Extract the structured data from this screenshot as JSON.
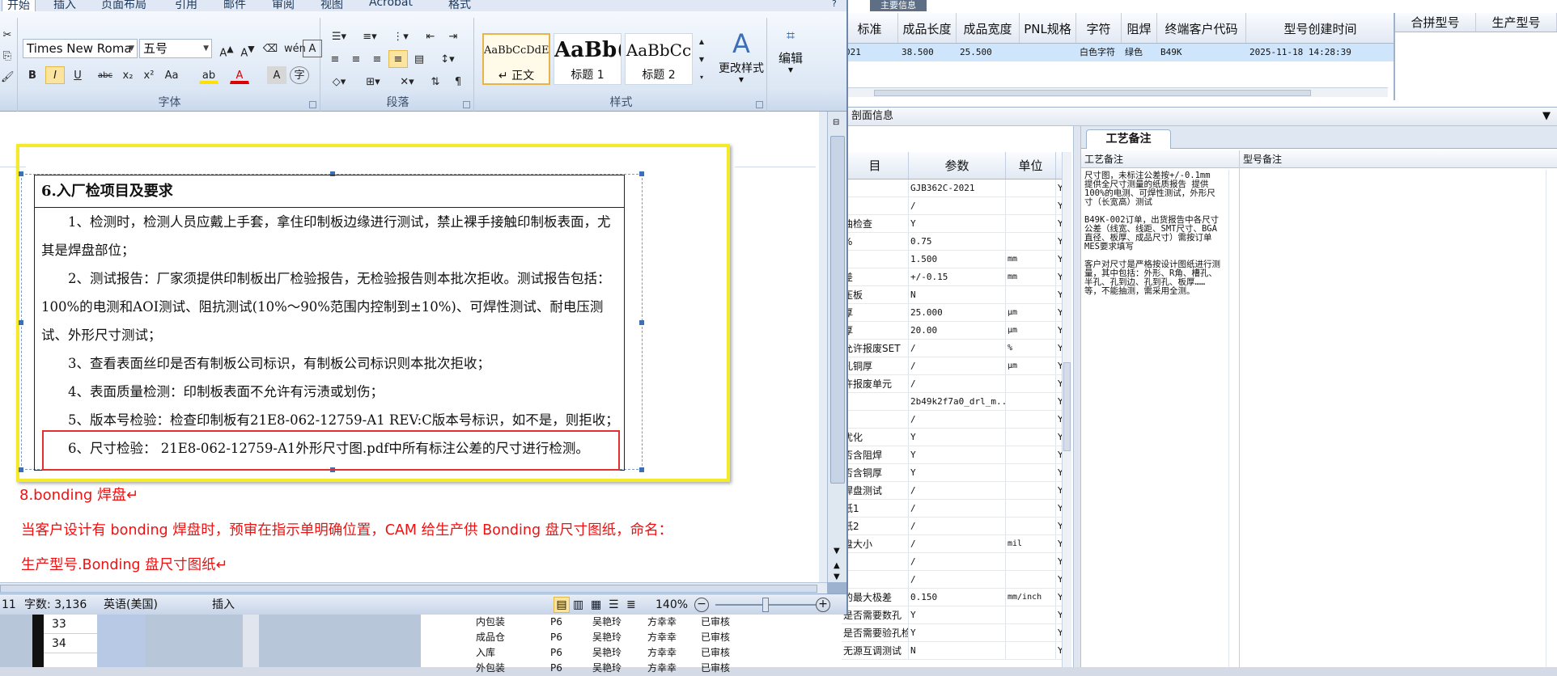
{
  "word": {
    "tabs": [
      "开始",
      "插入",
      "页面布局",
      "引用",
      "邮件",
      "审阅",
      "视图",
      "Acrobat",
      "格式"
    ],
    "font_name": "Times New Roma",
    "font_size": "五号",
    "groups": {
      "font": "字体",
      "paragraph": "段落",
      "styles": "样式",
      "change_styles": "更改样式",
      "edit": "编辑"
    },
    "styles": [
      {
        "preview": "AaBbCcDdEe",
        "name": "↵ 正文"
      },
      {
        "preview": "AaBb(",
        "name": "标题 1"
      },
      {
        "preview": "AaBbCc",
        "name": "标题 2"
      }
    ],
    "format_buttons": [
      "B",
      "I",
      "U",
      "abc",
      "x₂",
      "x²",
      "Aa",
      "A",
      "A"
    ],
    "status": {
      "page": "11",
      "word_count": "字数: 3,136",
      "language": "英语(美国)",
      "mode": "插入",
      "zoom": "140%"
    }
  },
  "document": {
    "section_title": "6.入厂检项目及要求",
    "paragraphs": [
      "1、检测时，检测人员应戴上手套，拿住印制板边缘进行测试，禁止裸手接触印制板表面，尤其是焊盘部位；",
      "2、测试报告：厂家须提供印制板出厂检验报告，无检验报告则本批次拒收。测试报告包括：100%的电测和AOI测试、阻抗测试(10%～90%范围内控制到±10%)、可焊性测试、耐电压测试、外形尺寸测试；",
      "3、查看表面丝印是否有制板公司标识，有制板公司标识则本批次拒收；",
      "4、表面质量检测：印制板表面不允许有污渍或划伤；",
      "5、版本号检验：检查印制板有21E8-062-12759-A1 REV:C版本号标识，如不是，则拒收；",
      "6、尺寸检验：  21E8-062-12759-A1外形尺寸图.pdf中所有标注公差的尺寸进行检测。"
    ],
    "bonding_title": "8.bonding 焊盘↵",
    "bonding_line1": "当客户设计有 bonding 焊盘时，预审在指示单明确位置，CAM 给生产供 Bonding 盘尺寸图纸，命名：",
    "bonding_line2": "生产型号.Bonding 盘尺寸图纸↵"
  },
  "erp": {
    "top_tab": "主要信息",
    "columns": [
      "标准",
      "成品长度",
      "成品宽度",
      "PNL规格",
      "字符",
      "阻焊",
      "终端客户代码",
      "型号创建时间"
    ],
    "row": [
      "021",
      "38.500",
      "25.500",
      "",
      "白色字符",
      "绿色",
      "B49K",
      "2025-11-18 14:28:39"
    ],
    "right_columns": [
      "合拼型号",
      "生产型号"
    ],
    "section_title": "剖面信息",
    "param_headers": [
      "目",
      "参数",
      "单位"
    ],
    "params": [
      [
        "",
        "GJB362C-2021",
        "",
        "Y"
      ],
      [
        "",
        "/",
        "",
        "Y"
      ],
      [
        "曲检查",
        "Y",
        "",
        "Y"
      ],
      [
        "%",
        "0.75",
        "",
        "Y"
      ],
      [
        "",
        "1.500",
        "mm",
        "Y"
      ],
      [
        "差",
        "+/-0.15",
        "mm",
        "Y"
      ],
      [
        "压板",
        "N",
        "",
        "Y"
      ],
      [
        "厚",
        "25.000",
        "μm",
        "Y"
      ],
      [
        "厚",
        "20.00",
        "μm",
        "Y"
      ],
      [
        "允许报废SET",
        "/",
        "%",
        "Y"
      ],
      [
        "孔铜厚",
        "/",
        "μm",
        "Y"
      ],
      [
        "许报废单元",
        "/",
        "",
        "Y"
      ],
      [
        "",
        "2b49k2f7a0_drl_m...",
        "",
        "Y"
      ],
      [
        "",
        "/",
        "",
        "Y"
      ],
      [
        "优化",
        "Y",
        "",
        "Y"
      ],
      [
        "否含阻焊",
        "Y",
        "",
        "Y"
      ],
      [
        "否含铜厚",
        "Y",
        "",
        "Y"
      ],
      [
        "焊盘测试",
        "/",
        "",
        "Y"
      ],
      [
        "纸1",
        "/",
        "",
        "Y"
      ],
      [
        "纸2",
        "/",
        "",
        "Y"
      ],
      [
        "盘大小",
        "/",
        "mil",
        "Y"
      ],
      [
        "",
        "/",
        "",
        "Y"
      ],
      [
        "",
        "/",
        "",
        "Y"
      ],
      [
        "的最大极差",
        "0.150",
        "mm/inch",
        "Y"
      ],
      [
        "是否需要数孔",
        "Y",
        "",
        "Y"
      ],
      [
        "是否需要验孔检查",
        "Y",
        "",
        "Y"
      ],
      [
        "无源互调测试",
        "N",
        "",
        "Y"
      ]
    ],
    "process_tab": "工艺备注",
    "process_header": "工艺备注",
    "model_header": "型号备注",
    "process_notes": [
      "尺寸图，未标注公差按+/-0.1mm 提供全尺寸测量的纸质报告 提供100%的电测、可焊性测试，外形尺寸（长宽高）测试",
      "B49K-002订单，出货报告中各尺寸公差（线宽、线距、SMT尺寸、BGA直径、板厚、成品尺寸）需按订单MES要求填写",
      "客户对尺寸是严格按设计图纸进行测量，其中包括：外形、R角、槽孔、半孔、孔到边、孔到孔、板厚……等，不能抽测，需采用全测。"
    ]
  },
  "bottom": {
    "row_numbers": [
      "33",
      "34"
    ],
    "tree": [
      [
        "内包装",
        "P6",
        "吴艳玲",
        "方幸幸",
        "已审核"
      ],
      [
        "成品仓",
        "P6",
        "吴艳玲",
        "方幸幸",
        "已审核"
      ],
      [
        "入库",
        "P6",
        "吴艳玲",
        "方幸幸",
        "已审核"
      ],
      [
        "外包装",
        "P6",
        "吴艳玲",
        "方幸幸",
        "已审核"
      ]
    ]
  }
}
